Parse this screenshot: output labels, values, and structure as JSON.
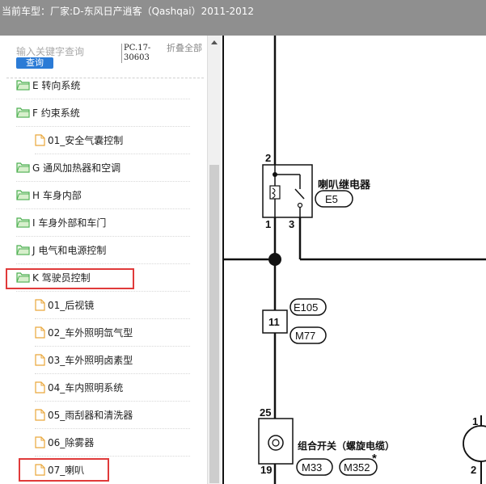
{
  "header": {
    "title": "当前车型：厂家:D-东风日产逍客（Qashqai）2011-2012"
  },
  "search": {
    "placeholder": "输入关键字查询",
    "button_label": "查询"
  },
  "version": "PC.17-30603",
  "fold_label": "折叠全部",
  "tree": [
    {
      "label": "E 转向系统",
      "type": "folder"
    },
    {
      "label": "F 约束系统",
      "type": "folder"
    },
    {
      "label": "01_安全气囊控制",
      "type": "file"
    },
    {
      "label": "G 通风加热器和空调",
      "type": "folder"
    },
    {
      "label": "H 车身内部",
      "type": "folder"
    },
    {
      "label": "I 车身外部和车门",
      "type": "folder"
    },
    {
      "label": "J 电气和电源控制",
      "type": "folder"
    },
    {
      "label": "K 驾驶员控制",
      "type": "folder"
    },
    {
      "label": "01_后视镜",
      "type": "file"
    },
    {
      "label": "02_车外照明氙气型",
      "type": "file"
    },
    {
      "label": "03_车外照明卤素型",
      "type": "file"
    },
    {
      "label": "04_车内照明系统",
      "type": "file"
    },
    {
      "label": "05_雨刮器和清洗器",
      "type": "file"
    },
    {
      "label": "06_除雾器",
      "type": "file"
    },
    {
      "label": "07_喇叭",
      "type": "file"
    }
  ],
  "diagram": {
    "relay_pin_top": "2",
    "relay_pin_bottom_left": "1",
    "relay_pin_bottom_right": "3",
    "relay_label": "喇叭继电器",
    "relay_connector": "E5",
    "middle_pin": "11",
    "middle_connector_top": "E105",
    "middle_connector_bottom": "M77",
    "switch_pin_top": "25",
    "switch_pin_bottom": "19",
    "switch_label": "组合开关（螺旋电缆）",
    "switch_connector_1": "M33",
    "switch_connector_2": "M352",
    "asterisk": "*",
    "right_pin_top": "1",
    "right_pin_bottom": "2"
  },
  "colors": {
    "highlight": "#e03a3a",
    "folder_icon": "#4caf50",
    "file_icon": "#e9a63a",
    "search_button": "#2b7bd6",
    "header_bg": "#8f8f8f"
  }
}
